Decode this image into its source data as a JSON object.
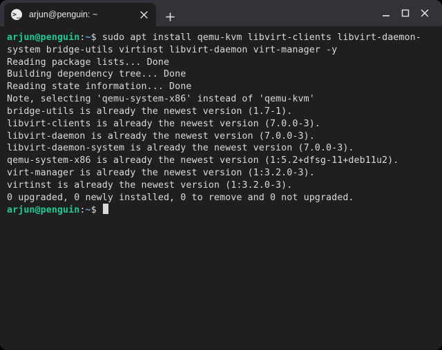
{
  "tab": {
    "title": "arjun@penguin: ~"
  },
  "prompt1": {
    "user_host": "arjun@penguin",
    "colon": ":",
    "cwd": "~",
    "dollar": "$ "
  },
  "prompt2": {
    "user_host": "arjun@penguin",
    "colon": ":",
    "cwd": "~",
    "dollar": "$ "
  },
  "command": "sudo apt install qemu-kvm libvirt-clients libvirt-daemon-system bridge-utils virtinst libvirt-daemon virt-manager -y",
  "output": [
    "Reading package lists... Done",
    "Building dependency tree... Done",
    "Reading state information... Done",
    "Note, selecting 'qemu-system-x86' instead of 'qemu-kvm'",
    "bridge-utils is already the newest version (1.7-1).",
    "libvirt-clients is already the newest version (7.0.0-3).",
    "libvirt-daemon is already the newest version (7.0.0-3).",
    "libvirt-daemon-system is already the newest version (7.0.0-3).",
    "qemu-system-x86 is already the newest version (1:5.2+dfsg-11+deb11u2).",
    "virt-manager is already the newest version (1:3.2.0-3).",
    "virtinst is already the newest version (1:3.2.0-3).",
    "0 upgraded, 0 newly installed, 0 to remove and 0 not upgraded."
  ]
}
